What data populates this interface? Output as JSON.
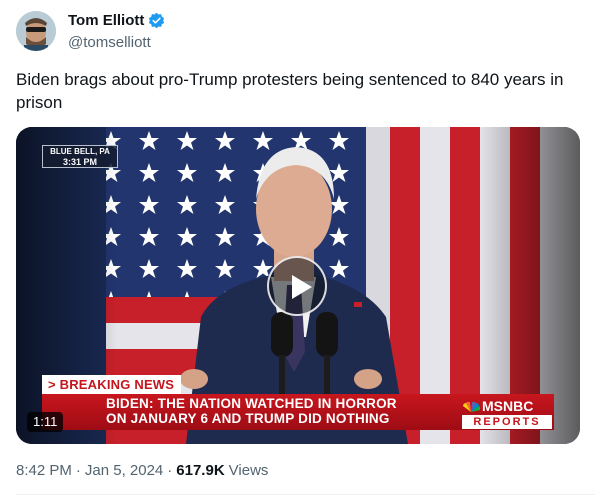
{
  "author": {
    "display_name": "Tom Elliott",
    "handle": "@tomselliott",
    "verified_icon": "verified-badge-icon",
    "verified_color": "#1d9bf0"
  },
  "tweet": {
    "text": "Biden brags about pro-Trump protesters being sentenced to 840 years in prison"
  },
  "media": {
    "type": "video",
    "duration": "1:11",
    "location_city": "BLUE BELL, PA",
    "location_time": "3:31 PM",
    "breaking_label": "> BREAKING NEWS",
    "headline_line1": "BIDEN: THE NATION WATCHED IN HORROR",
    "headline_line2": "ON JANUARY 6 AND TRUMP DID NOTHING",
    "network": "MSNBC",
    "network_sub": "REPORTS",
    "play_icon": "play-icon"
  },
  "meta": {
    "time": "8:42 PM",
    "separator": "·",
    "date": "Jan 5, 2024",
    "views_count": "617.9K",
    "views_label": "Views"
  },
  "colors": {
    "text_primary": "#0f1419",
    "text_secondary": "#536471",
    "breaking_red": "#c4161c"
  }
}
